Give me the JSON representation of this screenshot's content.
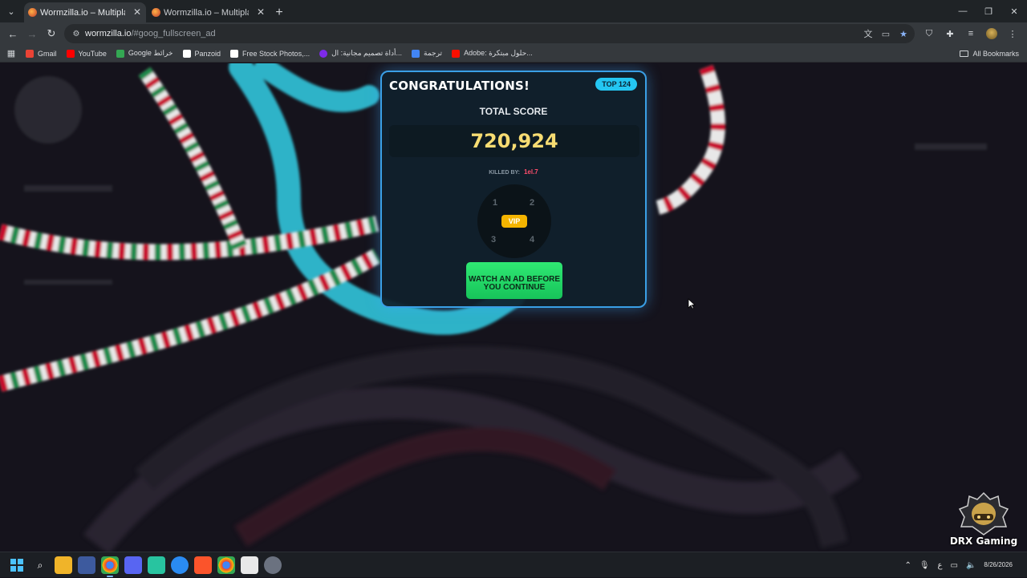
{
  "browser": {
    "tabs": [
      {
        "title": "Wormzilla.io – Multiplayer Snak",
        "active": true
      },
      {
        "title": "Wormzilla.io – Multiplayer Snak",
        "active": false
      }
    ],
    "url_host": "wormzilla.io",
    "url_rest": "/#goog_fullscreen_ad",
    "bookmarks": [
      {
        "label": "Gmail",
        "icon": "gmail-icon",
        "color": "#ea4335"
      },
      {
        "label": "YouTube",
        "icon": "youtube-icon",
        "color": "#ff0000"
      },
      {
        "label": "Google خرائط",
        "icon": "google-maps-icon",
        "color": "#34a853"
      },
      {
        "label": "Panzoid",
        "icon": "panzoid-icon",
        "color": "#ffffff"
      },
      {
        "label": "Free Stock Photos,...",
        "icon": "pexels-icon",
        "color": "#ffffff"
      },
      {
        "label": "أداة تصميم مجانية: ال...",
        "icon": "canva-icon",
        "color": "#7d2ae8"
      },
      {
        "label": "ترجمة",
        "icon": "translate-icon",
        "color": "#4285f4"
      },
      {
        "label": "Adobe: حلول مبتكرة...",
        "icon": "adobe-icon",
        "color": "#fa0f00"
      }
    ],
    "all_bookmarks_label": "All Bookmarks"
  },
  "game_over": {
    "title": "CONGRATULATIONS!",
    "rank_badge": "TOP 124",
    "score_label": "TOTAL SCORE",
    "score": "720,924",
    "killed_by_label": "KILLED BY:",
    "killed_by_name": "1el.7",
    "wheel_slots": [
      "1",
      "2",
      "3",
      "4"
    ],
    "vip_label": "VIP",
    "watch_button": "WATCH AN AD BEFORE YOU CONTINUE",
    "accent_color": "#3a9fe6",
    "score_color": "#f7dc72",
    "button_color": "#2fe873"
  },
  "watermark": {
    "text": "DRX Gaming"
  },
  "taskbar": {
    "apps": [
      "start-icon",
      "search-icon",
      "file-explorer-icon",
      "app-icon",
      "chrome-icon",
      "discord-icon",
      "app-icon",
      "app-icon",
      "brave-icon",
      "chrome-icon",
      "store-icon",
      "settings-icon"
    ],
    "date": "8/26/2026",
    "language": "ع"
  }
}
